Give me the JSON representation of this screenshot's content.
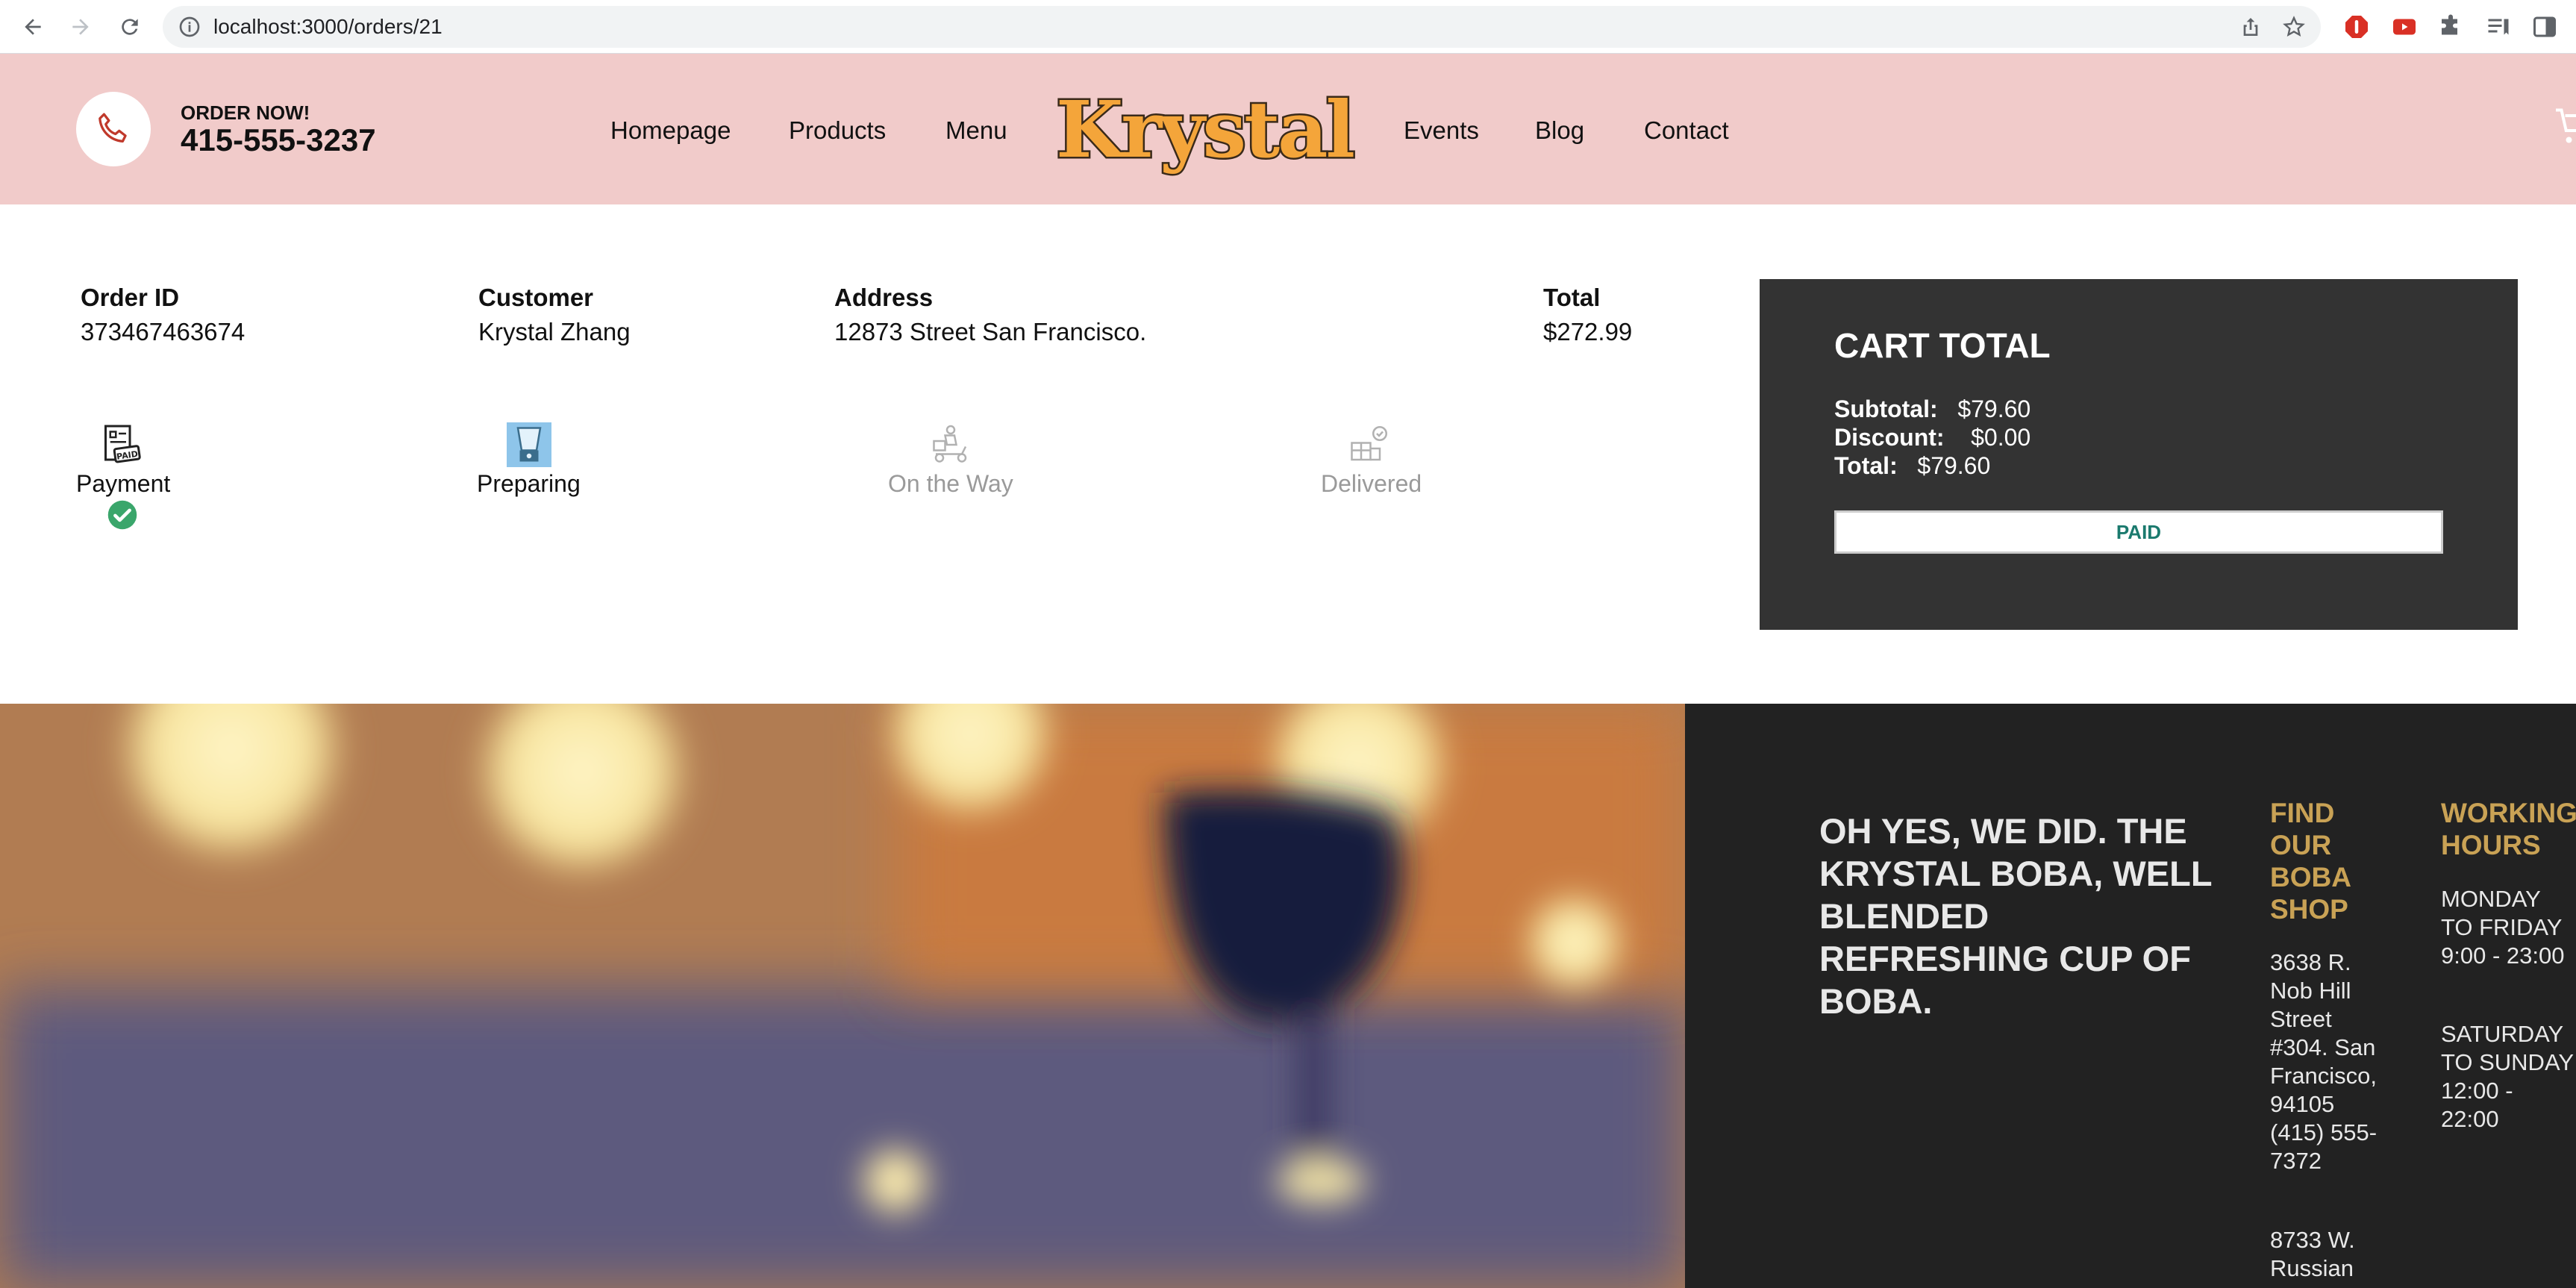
{
  "browser": {
    "url": "localhost:3000/orders/21"
  },
  "header": {
    "order_now": "ORDER NOW!",
    "phone": "415-555-3237",
    "nav_left": [
      "Homepage",
      "Products",
      "Menu"
    ],
    "logo_text": "Krystal",
    "nav_right": [
      "Events",
      "Blog",
      "Contact"
    ]
  },
  "order": {
    "order_id_label": "Order ID",
    "order_id": "373467463674",
    "customer_label": "Customer",
    "customer": "Krystal Zhang",
    "address_label": "Address",
    "address": "12873 Street San Francisco.",
    "total_label": "Total",
    "total": "$272.99"
  },
  "stages": [
    {
      "label": "Payment",
      "icon": "paid-receipt-icon",
      "status": "done"
    },
    {
      "label": "Preparing",
      "icon": "blender-icon",
      "status": "active"
    },
    {
      "label": "On the Way",
      "icon": "delivery-scooter-icon",
      "status": "pending"
    },
    {
      "label": "Delivered",
      "icon": "delivered-box-icon",
      "status": "pending"
    }
  ],
  "cart": {
    "title": "CART TOTAL",
    "subtotal_label": "Subtotal:",
    "subtotal": "$79.60",
    "discount_label": "Discount:",
    "discount": "$0.00",
    "total_label": "Total:",
    "total": "$79.60",
    "button": "PAID"
  },
  "footer": {
    "slogan": "OH YES, WE DID. THE KRYSTAL BOBA, WELL BLENDED REFRESHING CUP OF BOBA.",
    "find_heading": "FIND OUR BOBA SHOP",
    "location1": "3638 R. Nob Hill Street #304. San Francisco, 94105 (415) 555-7372",
    "location2": "8733 W. Russian",
    "hours_heading": "WORKING HOURS",
    "weekday_hours": "MONDAY TO FRIDAY 9:00 - 23:00",
    "weekend_hours": "SATURDAY TO SUNDAY 12:00 - 22:00"
  },
  "colors": {
    "header_bg": "#f1cbca",
    "cart_bg": "#333333",
    "footer_bg": "#222222",
    "footer_heading": "#c9a255",
    "paid_text": "#1b7a6e",
    "logo_fill": "#f4a53a",
    "check_green": "#3aa66b"
  }
}
